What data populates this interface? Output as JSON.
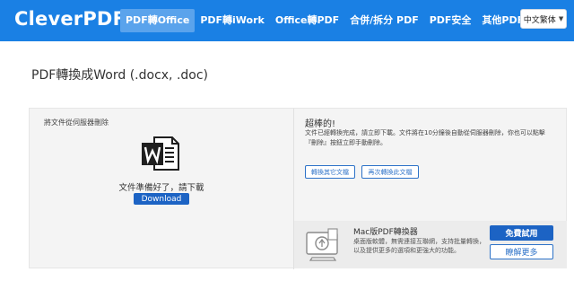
{
  "header": {
    "logo": "CleverPDF",
    "nav": [
      {
        "label": "PDF轉Office",
        "active": true
      },
      {
        "label": "PDF轉iWork",
        "active": false
      },
      {
        "label": "Office轉PDF",
        "active": false
      },
      {
        "label": "合併/拆分 PDF",
        "active": false
      },
      {
        "label": "PDF安全",
        "active": false
      },
      {
        "label": "其他PDF工具",
        "active": false
      }
    ],
    "language": "中文繁体"
  },
  "page": {
    "title": "PDF轉換成Word (.docx, .doc)"
  },
  "result": {
    "delete_note": "將文件從伺服器刪除",
    "ready_text": "文件準備好了，請下載",
    "download_label": "Download",
    "heading": "超棒的!",
    "message": "文件已經轉換完成，請立即下載。文件將在10分鐘後自動從伺服器刪除，你也可以點擊『刪除』按鈕立即手動刪除。",
    "convert_other_label": "轉換其它文檔",
    "convert_again_label": "再次轉換此文檔"
  },
  "promo": {
    "title": "Mac版PDF轉換器",
    "description": "桌面版軟體，無需連接互聯網，支持批量轉換，以及提供更多的選項和更強大的功能。",
    "trial_label": "免費試用",
    "more_label": "瞭解更多"
  },
  "colors": {
    "brand": "#1a80e4",
    "button": "#1c63c4",
    "word_icon": "#1f1f1f"
  },
  "icons": {
    "word_doc": "word-document-icon",
    "mac_converter": "mac-converter-icon",
    "caret": "chevron-down-icon"
  }
}
